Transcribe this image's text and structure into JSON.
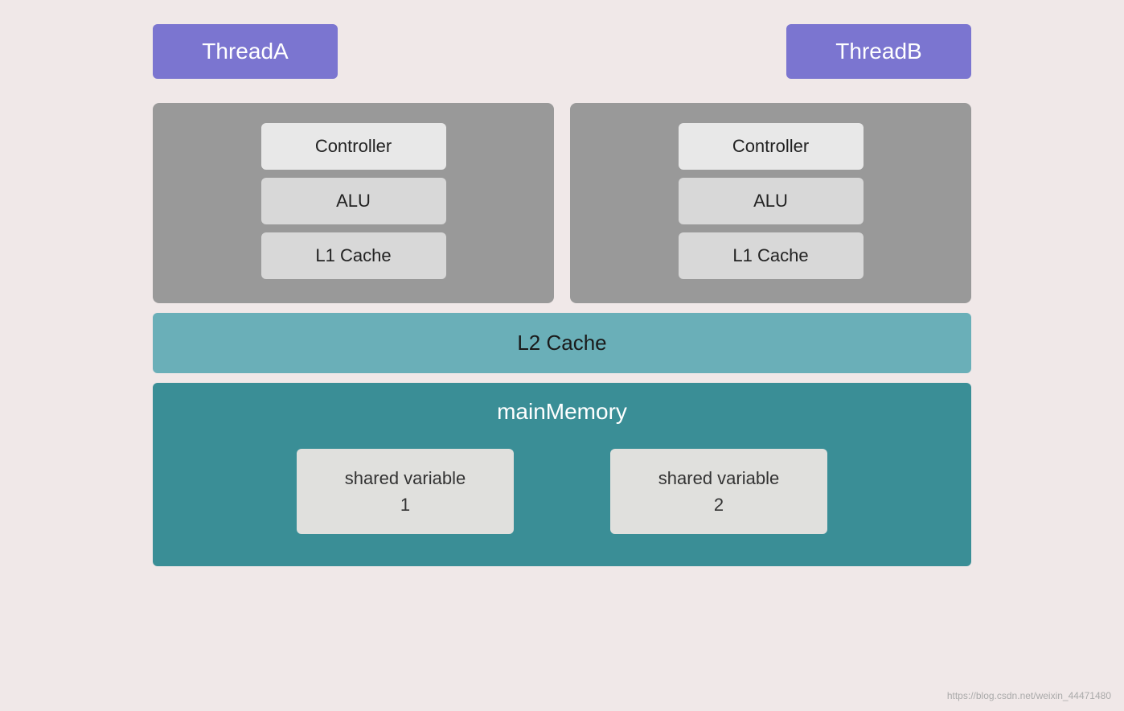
{
  "threads": {
    "threadA": {
      "label": "ThreadA"
    },
    "threadB": {
      "label": "ThreadB"
    }
  },
  "cpuA": {
    "controller": "Controller",
    "alu": "ALU",
    "l1cache": "L1 Cache"
  },
  "cpuB": {
    "controller": "Controller",
    "alu": "ALU",
    "l1cache": "L1 Cache"
  },
  "l2cache": {
    "label": "L2 Cache"
  },
  "mainMemory": {
    "label": "mainMemory",
    "sharedVar1Line1": "shared variable",
    "sharedVar1Line2": "1",
    "sharedVar2Line1": "shared variable",
    "sharedVar2Line2": "2"
  },
  "watermark": {
    "text": "https://blog.csdn.net/weixin_44471480"
  }
}
